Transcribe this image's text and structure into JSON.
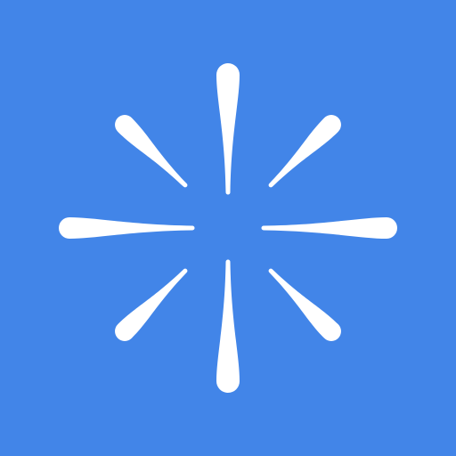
{
  "icon": {
    "name": "burst-logo-icon",
    "background_color": "#4285E8",
    "petal_color": "#FFFFFF",
    "petal_count": 8
  }
}
